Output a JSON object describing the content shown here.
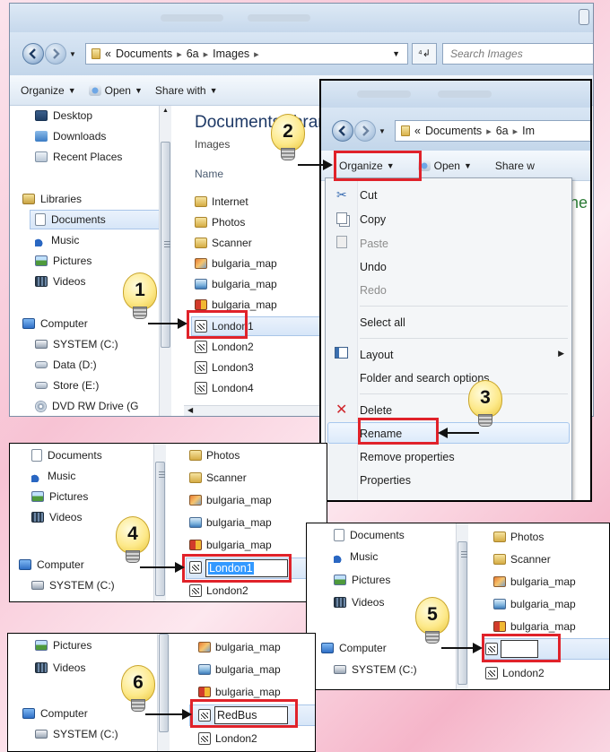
{
  "explorer": {
    "breadcrumb": {
      "prefix": "«",
      "items": [
        "Documents",
        "6a",
        "Images"
      ]
    },
    "breadcrumb_short": {
      "items": [
        "Documents",
        "6a",
        "Im"
      ]
    },
    "search_placeholder": "Search Images",
    "toolbar": {
      "organize": "Organize",
      "open": "Open",
      "share": "Share with",
      "share_short": "Share w"
    },
    "library_title": "Documents library",
    "library_sub": "Images",
    "col_name": "Name",
    "nav": {
      "desktop": "Desktop",
      "downloads": "Downloads",
      "recent": "Recent Places",
      "libraries": "Libraries",
      "documents": "Documents",
      "music": "Music",
      "pictures": "Pictures",
      "videos": "Videos",
      "computer": "Computer",
      "system": "SYSTEM (C:)",
      "data": "Data (D:)",
      "store": "Store (E:)",
      "dvd": "DVD RW Drive (G"
    },
    "files": [
      "Internet",
      "Photos",
      "Scanner",
      "bulgaria_map",
      "bulgaria_map",
      "bulgaria_map",
      "London1",
      "London2",
      "London3",
      "London4"
    ]
  },
  "menu": {
    "items": [
      "Cut",
      "Copy",
      "Paste",
      "Undo",
      "Redo",
      "Select all",
      "Layout",
      "Folder and search options",
      "Delete",
      "Rename",
      "Remove properties",
      "Properties"
    ]
  },
  "rename": {
    "before": "London1",
    "after": "RedBus",
    "next": "London2"
  },
  "steps": [
    "1",
    "2",
    "3",
    "4",
    "5",
    "6"
  ],
  "colors": {
    "highlight": "#e0222a",
    "accent": "#3399ff",
    "window_border": "#000000"
  }
}
